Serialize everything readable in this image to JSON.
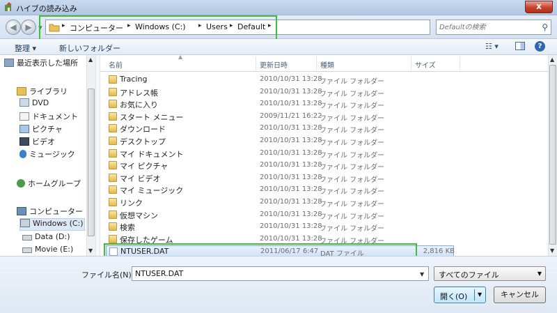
{
  "window": {
    "title": "ハイブの読み込み",
    "close_label": "x"
  },
  "address": {
    "crumbs": [
      "コンピューター",
      "Windows (C:)",
      "Users",
      "Default"
    ],
    "search_placeholder": "Defaultの検索"
  },
  "toolbar": {
    "organize_label": "整理 ▾",
    "new_folder_label": "新しいフォルダー"
  },
  "nav": {
    "items": [
      {
        "label": "最近表示した場所",
        "icon": "recent-places-icon"
      },
      {
        "label": "ライブラリ",
        "icon": "library-icon"
      },
      {
        "label": "DVD",
        "icon": "dvd-library-icon"
      },
      {
        "label": "ドキュメント",
        "icon": "documents-icon"
      },
      {
        "label": "ピクチャ",
        "icon": "pictures-icon"
      },
      {
        "label": "ビデオ",
        "icon": "videos-icon"
      },
      {
        "label": "ミュージック",
        "icon": "music-icon"
      },
      {
        "label": "ホームグループ",
        "icon": "homegroup-icon"
      },
      {
        "label": "コンピューター",
        "icon": "computer-icon"
      },
      {
        "label": "Windows (C:)",
        "icon": "windows-drive-icon"
      },
      {
        "label": "Data (D:)",
        "icon": "drive-icon"
      },
      {
        "label": "Movie (E:)",
        "icon": "drive-icon"
      }
    ]
  },
  "columns": {
    "name": "名前",
    "date": "更新日時",
    "type": "種類",
    "size": "サイズ"
  },
  "files": [
    {
      "name": "Tracing",
      "date": "2010/10/31 13:28",
      "type": "ファイル フォルダー",
      "size": ""
    },
    {
      "name": "アドレス帳",
      "date": "2010/10/31 13:28",
      "type": "ファイル フォルダー",
      "size": ""
    },
    {
      "name": "お気に入り",
      "date": "2010/10/31 13:28",
      "type": "ファイル フォルダー",
      "size": ""
    },
    {
      "name": "スタート メニュー",
      "date": "2009/11/21 16:22",
      "type": "ファイル フォルダー",
      "size": ""
    },
    {
      "name": "ダウンロード",
      "date": "2010/10/31 13:28",
      "type": "ファイル フォルダー",
      "size": ""
    },
    {
      "name": "デスクトップ",
      "date": "2010/10/31 13:28",
      "type": "ファイル フォルダー",
      "size": ""
    },
    {
      "name": "マイ ドキュメント",
      "date": "2010/10/31 13:28",
      "type": "ファイル フォルダー",
      "size": ""
    },
    {
      "name": "マイ ピクチャ",
      "date": "2010/10/31 13:28",
      "type": "ファイル フォルダー",
      "size": ""
    },
    {
      "name": "マイ ビデオ",
      "date": "2010/10/31 13:28",
      "type": "ファイル フォルダー",
      "size": ""
    },
    {
      "name": "マイ ミュージック",
      "date": "2010/10/31 13:28",
      "type": "ファイル フォルダー",
      "size": ""
    },
    {
      "name": "リンク",
      "date": "2010/10/31 13:28",
      "type": "ファイル フォルダー",
      "size": ""
    },
    {
      "name": "仮想マシン",
      "date": "2010/10/31 13:28",
      "type": "ファイル フォルダー",
      "size": ""
    },
    {
      "name": "検索",
      "date": "2010/10/31 13:28",
      "type": "ファイル フォルダー",
      "size": ""
    },
    {
      "name": "保存したゲーム",
      "date": "2010/10/31 13:28",
      "type": "ファイル フォルダー",
      "size": ""
    },
    {
      "name": "NTUSER.DAT",
      "date": "2011/06/17 6:47",
      "type": "DAT ファイル",
      "size": "2,816 KB"
    }
  ],
  "bottom": {
    "filename_label": "ファイル名(N):",
    "filename_value": "NTUSER.DAT",
    "filter_value": "すべてのファイル",
    "open_label": "開く(O)",
    "cancel_label": "キャンセル"
  },
  "colors": {
    "highlight": "#3fbf39",
    "selection": "#cde0f7"
  }
}
